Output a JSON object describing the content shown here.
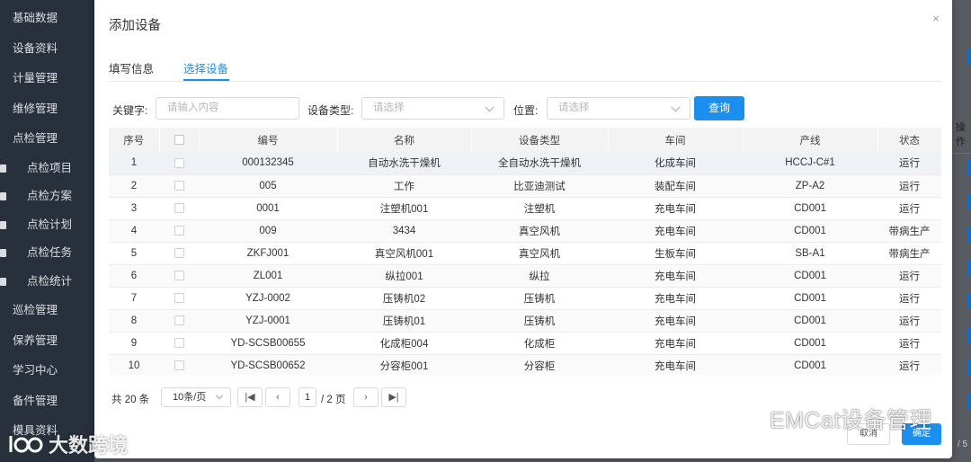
{
  "sidebar": {
    "items_top": [
      "基础数据",
      "设备资料",
      "计量管理",
      "维修管理",
      "点检管理"
    ],
    "sub_items": [
      "点检项目",
      "点检方案",
      "点检计划",
      "点检任务",
      "点检统计"
    ],
    "items_bottom": [
      "巡检管理",
      "保养管理",
      "学习中心",
      "备件管理",
      "模具资料"
    ]
  },
  "background": {
    "right_column_header": "操作",
    "right_page_text": "/ 5"
  },
  "modal": {
    "title": "添加设备",
    "close_glyph": "×",
    "tabs": [
      {
        "label": "填写信息",
        "active": false
      },
      {
        "label": "选择设备",
        "active": true
      }
    ],
    "filters": {
      "keyword_label": "关键字:",
      "keyword_placeholder": "请输入内容",
      "type_label": "设备类型:",
      "type_placeholder": "请选择",
      "location_label": "位置:",
      "location_placeholder": "请选择",
      "query_button": "查询"
    },
    "table": {
      "columns": [
        "序号",
        "",
        "编号",
        "名称",
        "设备类型",
        "车间",
        "产线",
        "状态"
      ],
      "rows": [
        [
          "1",
          "000132345",
          "自动水洗干燥机",
          "全自动水洗干燥机",
          "化成车间",
          "HCCJ-C#1",
          "运行"
        ],
        [
          "2",
          "005",
          "工作",
          "比亚迪测试",
          "装配车间",
          "ZP-A2",
          "运行"
        ],
        [
          "3",
          "0001",
          "注塑机001",
          "注塑机",
          "充电车间",
          "CD001",
          "运行"
        ],
        [
          "4",
          "009",
          "3434",
          "真空风机",
          "充电车间",
          "CD001",
          "带病生产"
        ],
        [
          "5",
          "ZKFJ001",
          "真空风机001",
          "真空风机",
          "生板车间",
          "SB-A1",
          "带病生产"
        ],
        [
          "6",
          "ZL001",
          "纵拉001",
          "纵拉",
          "充电车间",
          "CD001",
          "运行"
        ],
        [
          "7",
          "YZJ-0002",
          "压铸机02",
          "压铸机",
          "充电车间",
          "CD001",
          "运行"
        ],
        [
          "8",
          "YZJ-0001",
          "压铸机01",
          "压铸机",
          "充电车间",
          "CD001",
          "运行"
        ],
        [
          "9",
          "YD-SCSB00655",
          "化成柜004",
          "化成柜",
          "充电车间",
          "CD001",
          "运行"
        ],
        [
          "10",
          "YD-SCSB00652",
          "分容柜001",
          "分容柜",
          "充电车间",
          "CD001",
          "运行"
        ]
      ]
    },
    "pager": {
      "total": "共 20 条",
      "page_size": "10条/页",
      "first": "|◀",
      "prev": "‹",
      "current": "1",
      "of_pages": "/ 2 页",
      "next": "›",
      "last": "▶|"
    },
    "cancel_button": "取消",
    "ok_button": "确定"
  },
  "watermarks": {
    "right": "EMCat设备管理",
    "left": "大数跨境"
  },
  "colors": {
    "primary": "#1a8ff0",
    "sidebar_bg": "#2b3340"
  }
}
